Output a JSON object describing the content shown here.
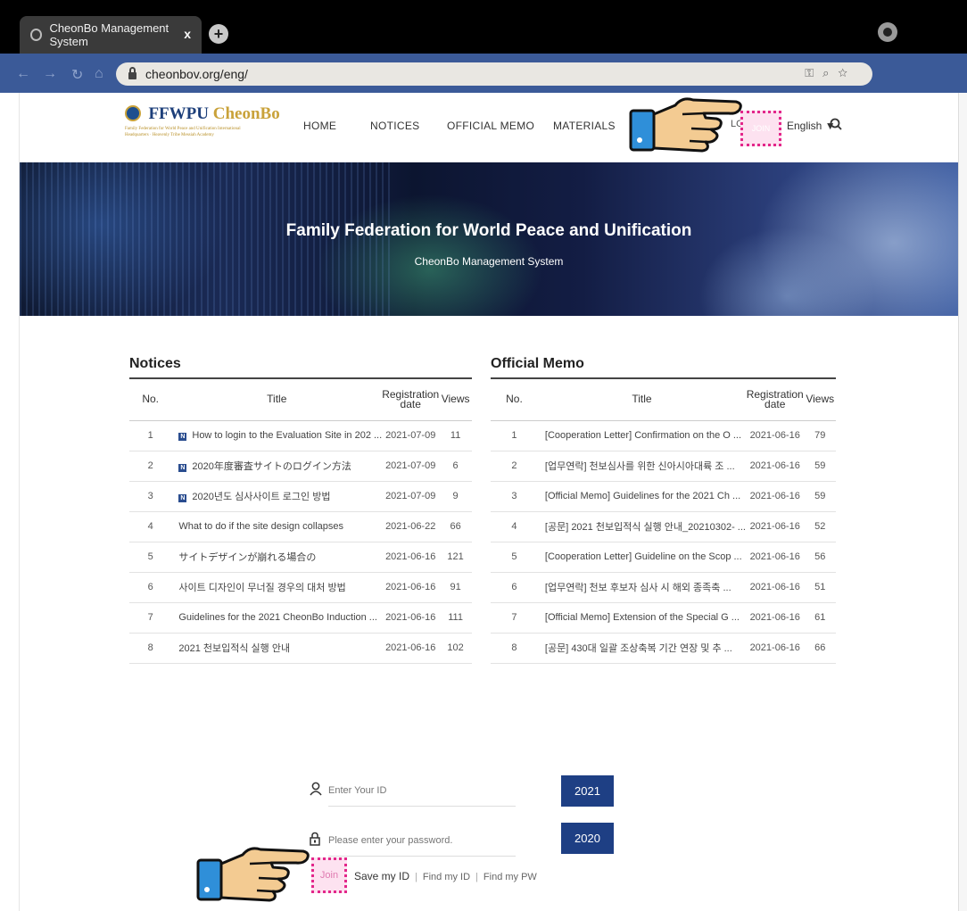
{
  "browser": {
    "tab_title": "CheonBo Management System",
    "tab_close": "x",
    "new_tab": "+",
    "url": "cheonbov.org/eng/"
  },
  "header": {
    "logo_primary": "FFWPU",
    "logo_secondary": "CheonBo",
    "logo_sub": "Family Federation for World Peace and Unification International Headquarters · Heavenly Tribe Messiah Academy",
    "nav": [
      "HOME",
      "NOTICES",
      "OFFICIAL MEMO",
      "MATERIALS"
    ],
    "login": "LOGIN",
    "join": "JOIN",
    "language": "English ▼"
  },
  "banner": {
    "title": "Family Federation for World Peace and Unification",
    "subtitle": "CheonBo Management System"
  },
  "notices": {
    "title": "Notices",
    "columns": [
      "No.",
      "Title",
      "Registration date",
      "Views"
    ],
    "rows": [
      {
        "no": "1",
        "new": true,
        "title": "How to login to the Evaluation Site in 202 ...",
        "date": "2021-07-09",
        "views": "11"
      },
      {
        "no": "2",
        "new": true,
        "title": "2020年度審査サイトのログイン方法",
        "date": "2021-07-09",
        "views": "6"
      },
      {
        "no": "3",
        "new": true,
        "title": "2020년도 심사사이트 로그인 방법",
        "date": "2021-07-09",
        "views": "9"
      },
      {
        "no": "4",
        "new": false,
        "title": "What to do if the site design collapses",
        "date": "2021-06-22",
        "views": "66"
      },
      {
        "no": "5",
        "new": false,
        "title": "サイトデザインが崩れる場合の",
        "date": "2021-06-16",
        "views": "121"
      },
      {
        "no": "6",
        "new": false,
        "title": "사이트 디자인이 무너질 경우의 대처 방법",
        "date": "2021-06-16",
        "views": "91"
      },
      {
        "no": "7",
        "new": false,
        "title": "Guidelines for the 2021 CheonBo Induction ...",
        "date": "2021-06-16",
        "views": "111"
      },
      {
        "no": "8",
        "new": false,
        "title": "2021 천보입적식 실행 안내",
        "date": "2021-06-16",
        "views": "102"
      }
    ]
  },
  "memo": {
    "title": "Official Memo",
    "columns": [
      "No.",
      "Title",
      "Registration date",
      "Views"
    ],
    "rows": [
      {
        "no": "1",
        "title": "[Cooperation Letter] Confirmation on the O ...",
        "date": "2021-06-16",
        "views": "79"
      },
      {
        "no": "2",
        "title": "[업무연락] 천보심사를 위한 신아시아대륙 조 ...",
        "date": "2021-06-16",
        "views": "59"
      },
      {
        "no": "3",
        "title": "[Official Memo] Guidelines for the 2021 Ch ...",
        "date": "2021-06-16",
        "views": "59"
      },
      {
        "no": "4",
        "title": "[공문] 2021 천보입적식 실행 안내_20210302- ...",
        "date": "2021-06-16",
        "views": "52"
      },
      {
        "no": "5",
        "title": "[Cooperation Letter] Guideline on the Scop ...",
        "date": "2021-06-16",
        "views": "56"
      },
      {
        "no": "6",
        "title": "[업무연락] 천보 후보자 심사 시 해외 종족축 ...",
        "date": "2021-06-16",
        "views": "51"
      },
      {
        "no": "7",
        "title": "[Official Memo] Extension of the Special G ...",
        "date": "2021-06-16",
        "views": "61"
      },
      {
        "no": "8",
        "title": "[공문] 430대 일괄 조상축복 기간 연장 및 추 ...",
        "date": "2021-06-16",
        "views": "66"
      }
    ]
  },
  "login_form": {
    "id_placeholder": "Enter Your ID",
    "pw_placeholder": "Please enter your password.",
    "btn_2021": "2021",
    "btn_2020": "2020",
    "join": "Join",
    "save_id": "Save my ID",
    "find_id": "Find my ID",
    "find_pw": "Find my PW",
    "separator": "|"
  },
  "colors": {
    "accent": "#1e3f84",
    "highlight": "#e3268a",
    "highlight_fill": "#fde2f0"
  }
}
